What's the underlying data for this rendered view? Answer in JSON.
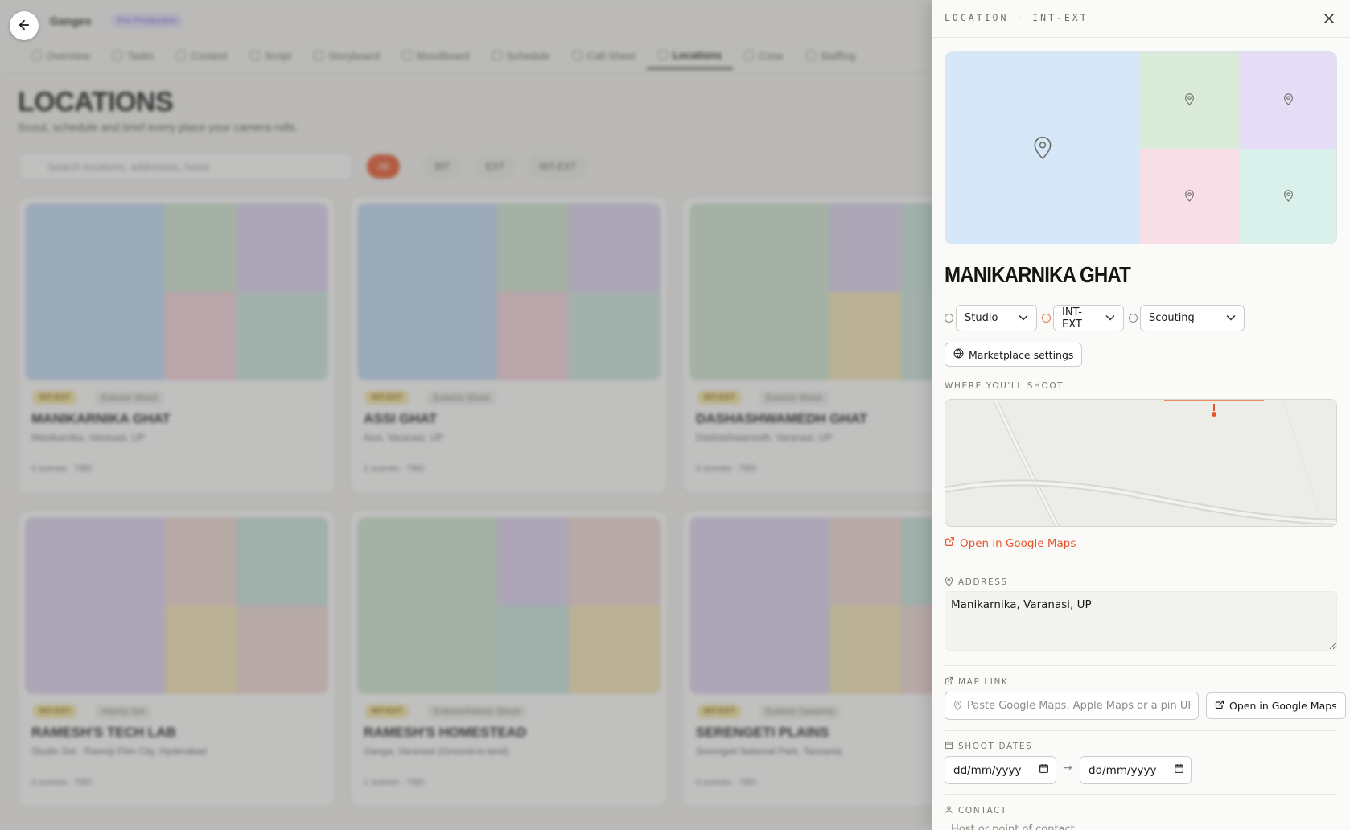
{
  "background": {
    "project_name": "Ganges",
    "project_badge": "Pre-Production",
    "tabs": [
      {
        "label": "Overview",
        "active": false
      },
      {
        "label": "Tasks",
        "active": false
      },
      {
        "label": "Content",
        "active": false
      },
      {
        "label": "Script",
        "active": false
      },
      {
        "label": "Storyboard",
        "active": false
      },
      {
        "label": "Moodboard",
        "active": false
      },
      {
        "label": "Schedule",
        "active": false
      },
      {
        "label": "Call Sheet",
        "active": false
      },
      {
        "label": "Locations",
        "active": true
      },
      {
        "label": "Crew",
        "active": false
      },
      {
        "label": "Staffing",
        "active": false
      }
    ],
    "heading": "LOCATIONS",
    "subheading": "Scout, schedule and brief every place your camera rolls.",
    "search_placeholder": "Search locations, addresses, hosts",
    "filters": [
      "All",
      "INT",
      "EXT",
      "INT-EXT"
    ],
    "cards": [
      {
        "tag": "INT-EXT",
        "tag2": "Exterior Shoot",
        "title": "MANIKARNIKA GHAT",
        "location": "Manikarnika, Varanasi, UP",
        "meta": "0 scenes · TBD",
        "colors": [
          "#c2dbf4",
          "#cfe5d0",
          "#ddd3f0",
          "#f4d3dc",
          "#cde6df"
        ]
      },
      {
        "tag": "INT-EXT",
        "tag2": "Exterior Shoot",
        "title": "ASSI GHAT",
        "location": "Assi, Varanasi, UP",
        "meta": "2 scenes · TBD",
        "colors": [
          "#c2dbf4",
          "#cfe5d0",
          "#ddd3f0",
          "#f4d3dc",
          "#cde6df"
        ]
      },
      {
        "tag": "INT-EXT",
        "tag2": "Exterior Shoot",
        "title": "DASHASHWAMEDH GHAT",
        "location": "Dashashwamedh, Varanasi, UP",
        "meta": "0 scenes · TBD",
        "colors": [
          "#cfe5d0",
          "#ddd3f0",
          "#c9e3dc",
          "#f4e5b6",
          "#cde6df"
        ]
      },
      {
        "tag": "INT-EXT",
        "tag2": "Interior Set",
        "title": "RAMESH'S TECH LAB",
        "location": "Studio Set · Ramoji Film City, Hyderabad",
        "meta": "0 scenes · TBD",
        "colors": [
          "#ddd3f0",
          "#f0d8d5",
          "#c9e3dc",
          "#f4e5b6",
          "#f0d8d5"
        ]
      },
      {
        "tag": "INT-EXT",
        "tag2": "Exterior/Interior Shoot",
        "title": "RAMESH'S HOMESTEAD",
        "location": "Ganga, Varanasi (Ground-in-land)",
        "meta": "1 scenes · TBD",
        "colors": [
          "#cfe5d0",
          "#ddd3f0",
          "#f0d8d5",
          "#c9e3dc",
          "#f4e5b6"
        ]
      },
      {
        "tag": "INT-EXT",
        "tag2": "Exterior Savanna",
        "title": "SERENGETI PLAINS",
        "location": "Serengeti National Park, Tanzania",
        "meta": "0 scenes · TBD",
        "colors": [
          "#ddd3f0",
          "#f0d8d5",
          "#c9e3dc",
          "#f4e5b6",
          "#f0d8d5"
        ]
      }
    ]
  },
  "drawer": {
    "eyebrow": "LOCATION · INT-EXT",
    "title": "MANIKARNIKA GHAT",
    "mosaic_colors": [
      "#d6e8f8",
      "#daebd9",
      "#e5ddf5",
      "#f8dee7",
      "#daf0ea"
    ],
    "selects": {
      "type": "Studio",
      "setting": "INT-EXT",
      "status": "Scouting"
    },
    "marketplace_label": "Marketplace settings",
    "where_label": "WHERE YOU'LL SHOOT",
    "open_maps_label": "Open in Google Maps",
    "address_label": "ADDRESS",
    "address_value": "Manikarnika, Varanasi, UP",
    "map_link_label": "MAP LINK",
    "map_link_placeholder": "Paste Google Maps, Apple Maps or a pin URL",
    "map_link_button": "Open in Google Maps",
    "shoot_dates_label": "SHOOT DATES",
    "date_from": "dd/mm/yyyy",
    "date_arrow": "→",
    "date_to": "dd/mm/yyyy",
    "contact_label": "CONTACT",
    "contact_hint": "Host or point of contact"
  },
  "colors": {
    "accent": "#e8542a",
    "text": "#1c1b19",
    "muted": "#7b7a76"
  }
}
